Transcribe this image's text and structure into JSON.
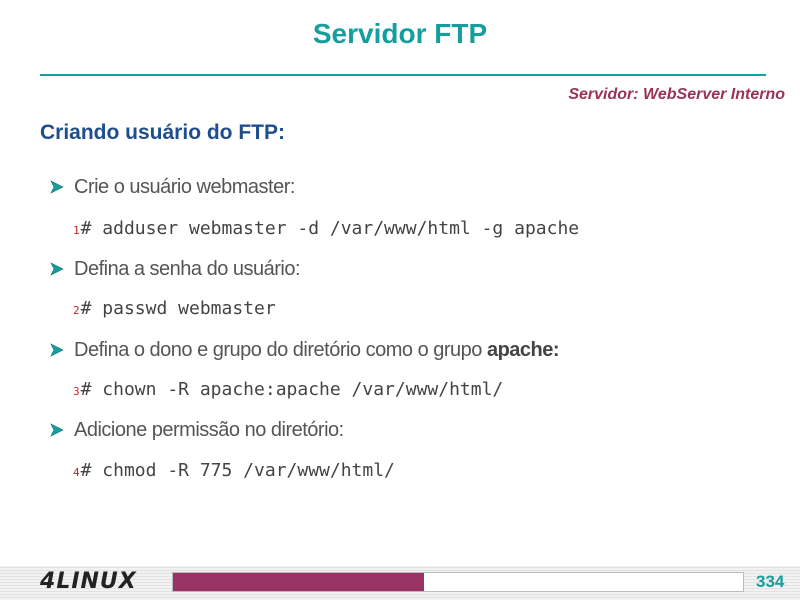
{
  "slide": {
    "title": "Servidor FTP",
    "subtitle": "Servidor: WebServer Interno",
    "section_heading": "Criando usuário do FTP:"
  },
  "steps": [
    {
      "text": "Crie o usuário webmaster:",
      "bold": "",
      "line_number": "1",
      "command": "# adduser webmaster -d /var/www/html -g apache"
    },
    {
      "text": "Defina a senha do usuário:",
      "bold": "",
      "line_number": "2",
      "command": "# passwd webmaster"
    },
    {
      "text": "Defina o dono e grupo do diretório como o grupo ",
      "bold": "apache:",
      "line_number": "3",
      "command": "# chown -R apache:apache /var/www/html/"
    },
    {
      "text": "Adicione permissão no diretório:",
      "bold": "",
      "line_number": "4",
      "command": "# chmod -R 775 /var/www/html/"
    }
  ],
  "footer": {
    "logo_digit": "4",
    "logo_text": "LINUX",
    "page_number": "334",
    "progress_fraction": 0.44
  },
  "colors": {
    "title": "#169e9e",
    "subtitle": "#993355",
    "heading": "#1f4e8c",
    "progress": "#993366",
    "line_number": "#cc2222"
  },
  "icons": {
    "bullet": "arrow-bullet-icon"
  }
}
